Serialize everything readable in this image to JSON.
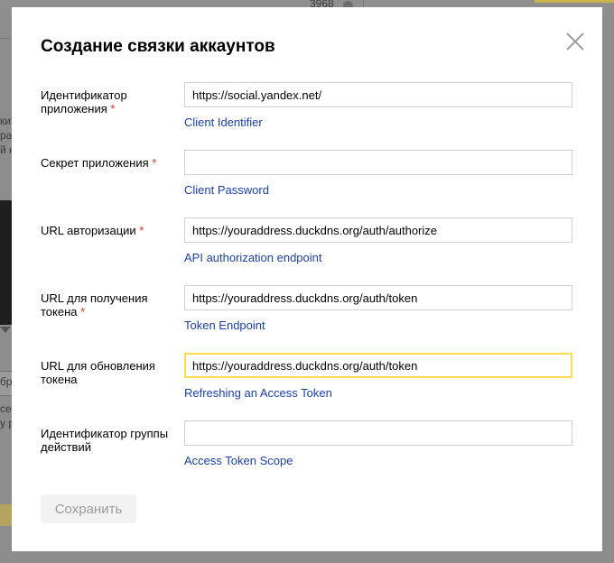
{
  "background": {
    "count": "3968",
    "fragments": [
      "ките",
      "раб",
      "й ко",
      "бр",
      "сер",
      "у р"
    ]
  },
  "dialog": {
    "title": "Создание связки аккаунтов",
    "required_mark": "*",
    "fields": [
      {
        "label": "Идентификатор приложения",
        "required": true,
        "value": "https://social.yandex.net/",
        "placeholder": "",
        "hint": "Client Identifier"
      },
      {
        "label": "Секрет приложения",
        "required": true,
        "value": "",
        "placeholder": "",
        "hint": "Client Password"
      },
      {
        "label": "URL авторизации",
        "required": true,
        "value": "https://youraddress.duckdns.org/auth/authorize",
        "placeholder": "",
        "hint": "API authorization endpoint"
      },
      {
        "label": "URL для получения токена",
        "required": true,
        "value": "https://youraddress.duckdns.org/auth/token",
        "placeholder": "",
        "hint": "Token Endpoint"
      },
      {
        "label": "URL для обновления токена",
        "required": false,
        "value": "https://youraddress.duckdns.org/auth/token",
        "placeholder": "",
        "hint": "Refreshing an Access Token"
      },
      {
        "label": "Идентификатор группы действий",
        "required": false,
        "value": "",
        "placeholder": "",
        "hint": "Access Token Scope"
      }
    ],
    "save_label": "Сохранить",
    "colors": {
      "focus_border": "#ffdb4d",
      "link": "#1a3fad",
      "required": "#e0311b"
    }
  }
}
